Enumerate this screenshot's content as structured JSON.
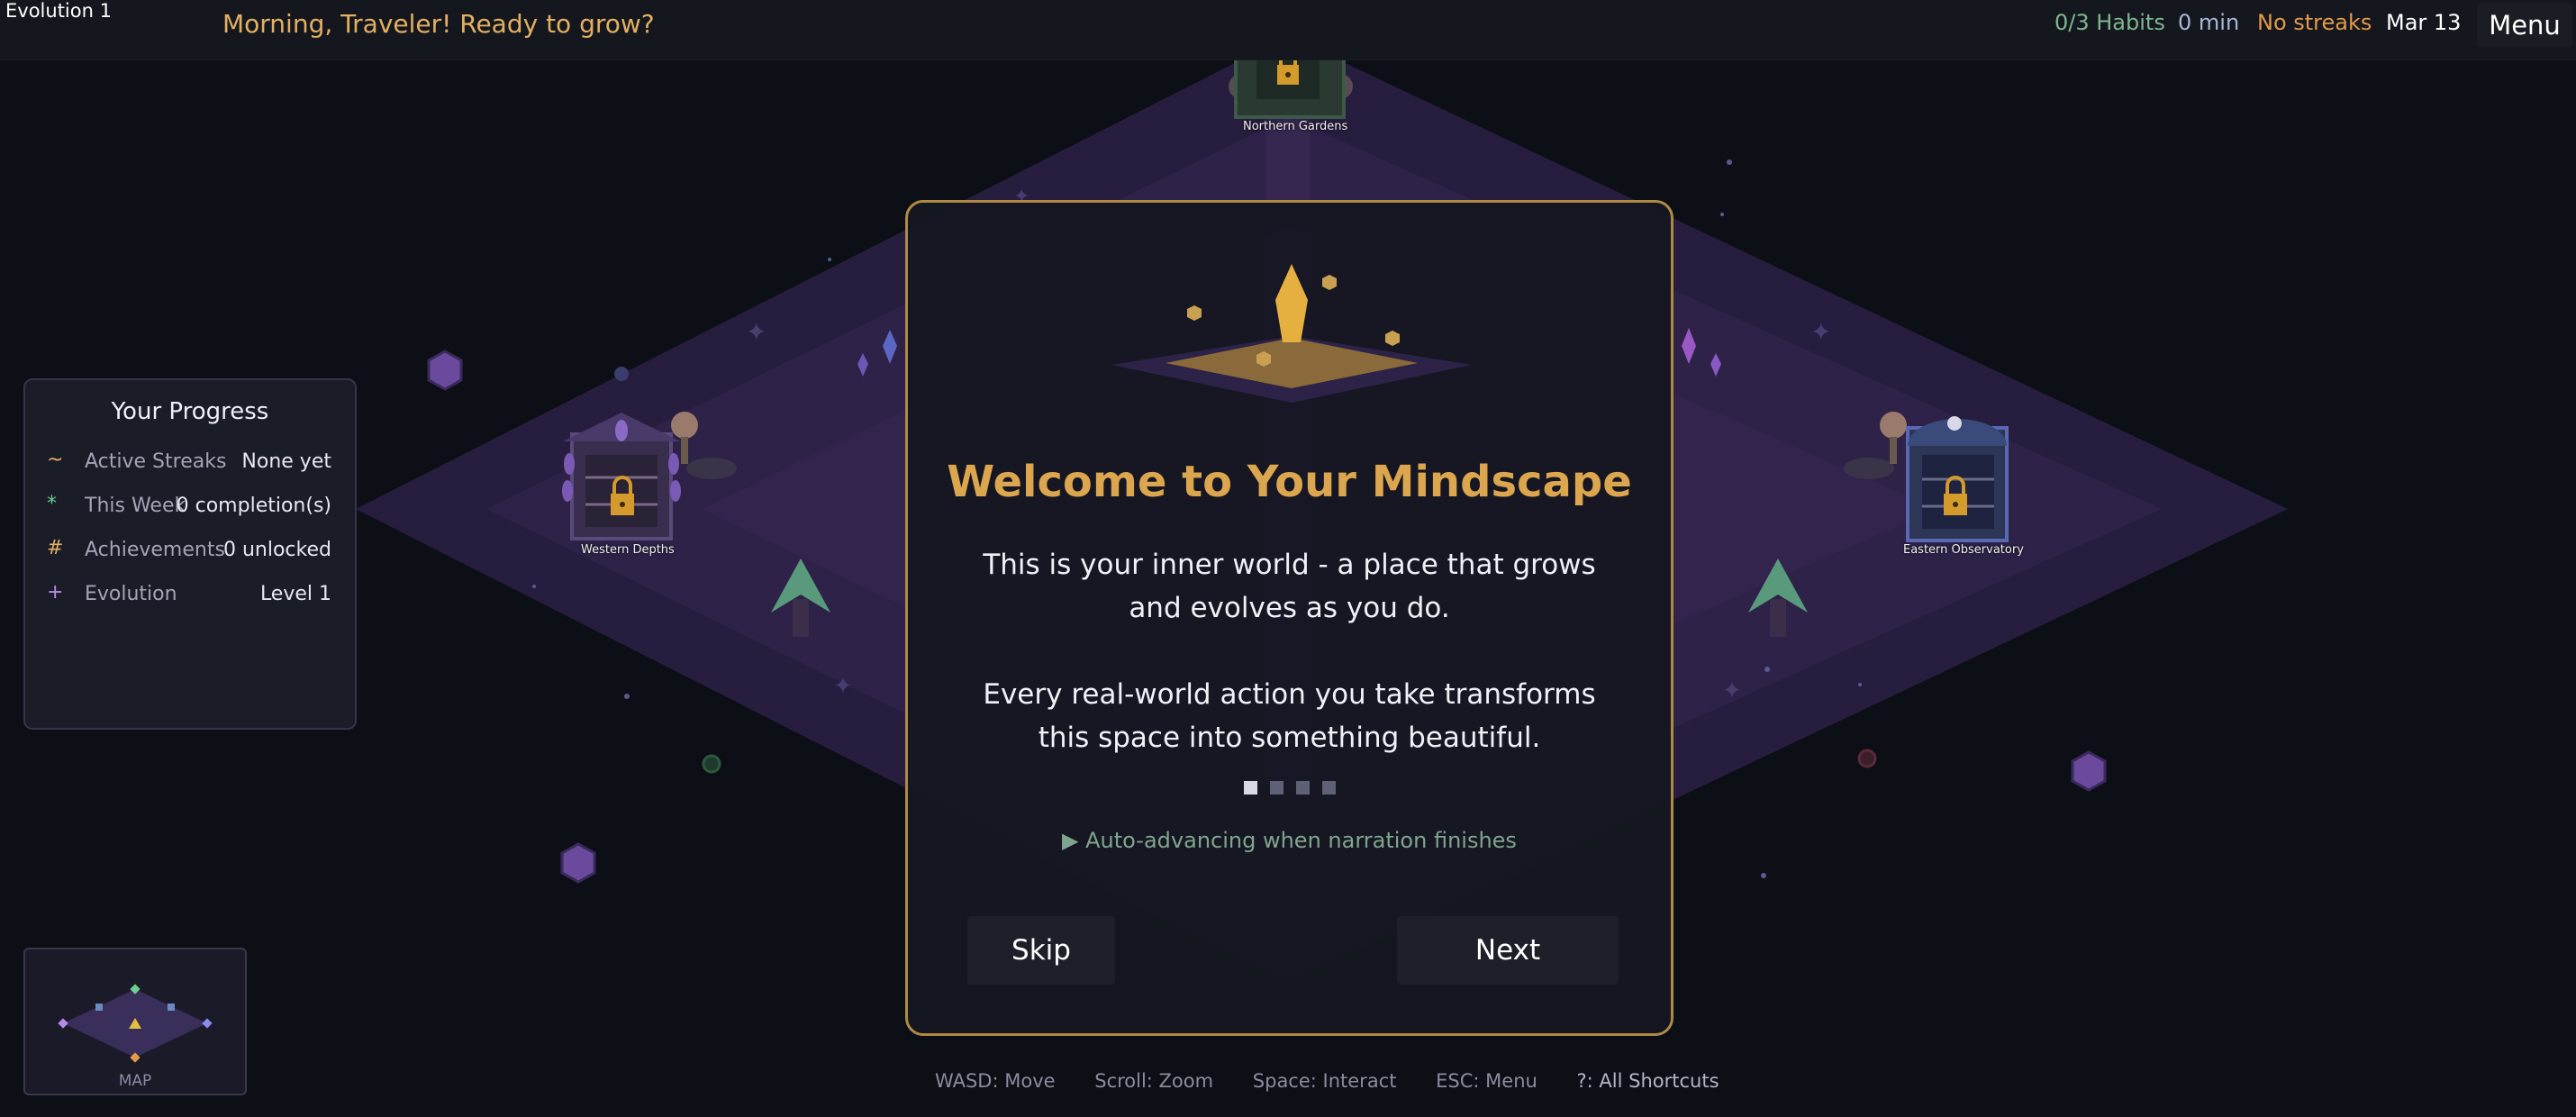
{
  "header": {
    "evolution_label": "Evolution 1",
    "greeting": "Morning, Traveler! Ready to grow?",
    "habits": "0/3 Habits",
    "minutes": "0 min",
    "streaks": "No streaks",
    "date": "Mar 13",
    "menu": "Menu"
  },
  "colors": {
    "accent_gold": "#dba64e",
    "habits": "#7fb78f",
    "minutes": "#a8b7d8",
    "streaks": "#e39a48",
    "modal_border": "#b08a45",
    "realm": "#3a2a5c"
  },
  "progress": {
    "title": "Your Progress",
    "rows": [
      {
        "icon": "~",
        "label": "Active Streaks",
        "value": "None yet",
        "color": "#e3b061"
      },
      {
        "icon": "*",
        "label": "This Week",
        "value": "0 completion(s)",
        "color": "#6fcf8f"
      },
      {
        "icon": "#",
        "label": "Achievements",
        "value": "0 unlocked",
        "color": "#e3b061"
      },
      {
        "icon": "+",
        "label": "Evolution",
        "value": "Level 1",
        "color": "#b88be8"
      }
    ]
  },
  "buildings": {
    "north": "Northern Gardens",
    "west": "Western Depths",
    "east": "Eastern Observatory"
  },
  "minimap": {
    "label": "MAP"
  },
  "modal": {
    "title": "Welcome to Your Mindscape",
    "paragraph1": "This is your inner world - a place that grows and evolves as you do.",
    "paragraph2": "Every real-world action you take transforms this space into something beautiful.",
    "step_current": 1,
    "step_total": 4,
    "auto_advance": "▶ Auto-advancing when narration finishes",
    "skip": "Skip",
    "next": "Next"
  },
  "hints": [
    "WASD: Move",
    "Scroll: Zoom",
    "Space: Interact",
    "ESC: Menu",
    "?: All Shortcuts"
  ]
}
